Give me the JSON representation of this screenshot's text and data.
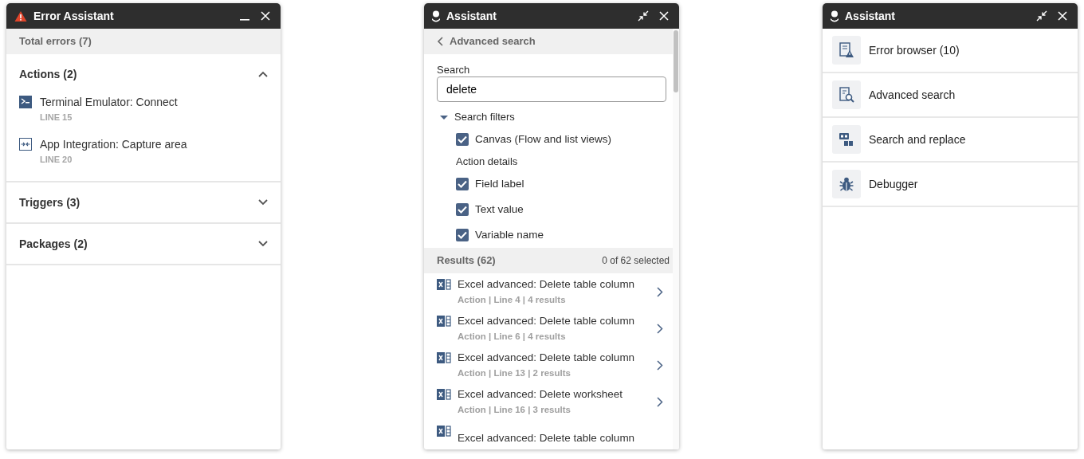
{
  "panels": [
    {
      "kind": "error_assistant",
      "title": "Error Assistant",
      "summary": "Total errors (7)",
      "sections": [
        {
          "title": "Actions (2)",
          "expanded": true,
          "items": [
            {
              "kind": "terminal",
              "name": "Terminal Emulator: Connect",
              "line": "LINE 15"
            },
            {
              "kind": "capture",
              "name": "App Integration: Capture area",
              "line": "LINE 20"
            }
          ]
        },
        {
          "title": "Triggers (3)",
          "expanded": false
        },
        {
          "title": "Packages (2)",
          "expanded": false
        }
      ]
    },
    {
      "kind": "advanced_search",
      "title": "Assistant",
      "back_label": "Advanced search",
      "search": {
        "label": "Search",
        "value": "delete"
      },
      "filters": {
        "label": "Search filters",
        "expanded": true,
        "groups": [
          {
            "options": [
              {
                "label": "Canvas (Flow and list views)",
                "checked": true
              }
            ]
          },
          {
            "heading": "Action details",
            "options": [
              {
                "label": "Field label",
                "checked": true
              },
              {
                "label": "Text value",
                "checked": true
              },
              {
                "label": "Variable name",
                "checked": true
              }
            ]
          }
        ]
      },
      "results": {
        "title": "Results (62)",
        "selection": "0 of 62 selected",
        "items": [
          {
            "title": "Excel advanced: Delete table column",
            "meta": "Action | Line 4 | 4 results"
          },
          {
            "title": "Excel advanced: Delete table column",
            "meta": "Action | Line 6 | 4 results"
          },
          {
            "title": "Excel advanced: Delete table column",
            "meta": "Action | Line 13 | 2 results"
          },
          {
            "title": "Excel advanced: Delete worksheet",
            "meta": "Action | Line 16 | 3 results"
          },
          {
            "title": "Excel advanced: Delete table column"
          }
        ]
      }
    },
    {
      "kind": "menu",
      "title": "Assistant",
      "items": [
        {
          "kind": "error_browser",
          "label": "Error browser (10)"
        },
        {
          "kind": "advanced_search",
          "label": "Advanced search"
        },
        {
          "kind": "search_replace",
          "label": "Search and replace"
        },
        {
          "kind": "debugger",
          "label": "Debugger"
        }
      ]
    }
  ]
}
